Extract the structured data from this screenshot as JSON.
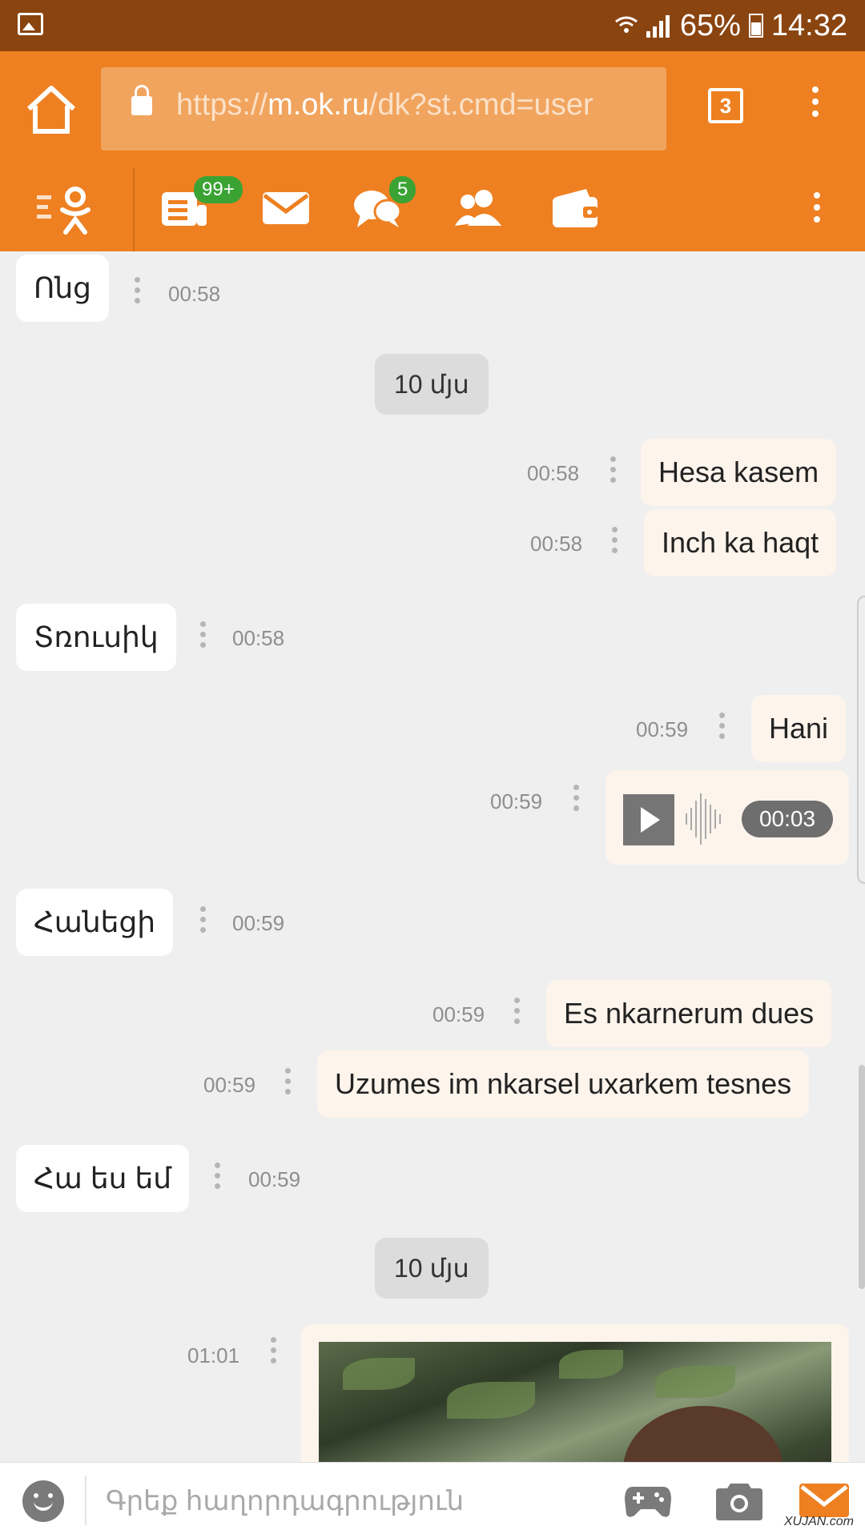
{
  "status_bar": {
    "battery": "65%",
    "time": "14:32"
  },
  "browser": {
    "url_scheme": "https://",
    "url_host": "m.ok.ru",
    "url_path": "/dk?st.cmd=user",
    "tab_count": "3"
  },
  "app_nav": {
    "feed_badge": "99+",
    "discussions_badge": "5"
  },
  "messages": [
    {
      "side": "in",
      "text": "Ոնց",
      "time": "00:58"
    },
    {
      "type": "date",
      "text": "10 մյս"
    },
    {
      "side": "out",
      "text": "Hesa kasem",
      "time": "00:58"
    },
    {
      "side": "out",
      "text": "Inch ka haqt",
      "time": "00:58"
    },
    {
      "side": "in",
      "text": "Տռուսիկ",
      "time": "00:58"
    },
    {
      "side": "out",
      "text": "Hani",
      "time": "00:59"
    },
    {
      "side": "out",
      "type": "voice",
      "duration": "00:03",
      "time": "00:59"
    },
    {
      "side": "in",
      "text": "Հանեցի",
      "time": "00:59"
    },
    {
      "side": "out",
      "text": "Es nkarnerum dues",
      "time": "00:59"
    },
    {
      "side": "out",
      "text": "Uzumes im nkarsel uxarkem tesnes",
      "time": "00:59"
    },
    {
      "side": "in",
      "text": "Հա ես եմ",
      "time": "00:59"
    },
    {
      "type": "date",
      "text": "10 մյս"
    },
    {
      "side": "out",
      "type": "photo",
      "time": "01:01"
    }
  ],
  "composer": {
    "placeholder": "Գրեք հաղորդագրություն"
  },
  "watermark": "XUJAN.com",
  "colors": {
    "brand_orange": "#ee8021",
    "status_brown": "#8a4410",
    "badge_green": "#3aa334"
  },
  "icons": [
    "gallery-icon",
    "wifi-icon",
    "signal-icon",
    "battery-icon",
    "home-icon",
    "lock-icon",
    "ok-logo-icon",
    "feed-icon",
    "mail-icon",
    "discussions-icon",
    "friends-icon",
    "wallet-icon",
    "smiley-icon",
    "gamepad-icon",
    "camera-icon",
    "send-icon"
  ]
}
